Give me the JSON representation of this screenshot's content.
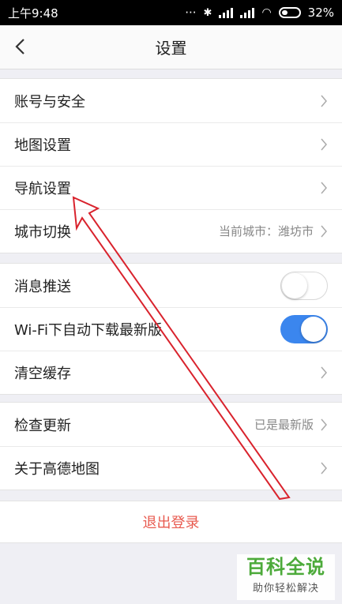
{
  "status_bar": {
    "time": "上午9:48",
    "battery": "32%",
    "icons": [
      "bluetooth-icon",
      "signal-icon",
      "wifi-icon",
      "battery-icon"
    ]
  },
  "nav": {
    "title": "设置",
    "back_icon": "chevron-left-icon"
  },
  "group1": [
    {
      "label": "账号与安全",
      "value": ""
    },
    {
      "label": "地图设置",
      "value": ""
    },
    {
      "label": "导航设置",
      "value": ""
    },
    {
      "label": "城市切换",
      "value": "当前城市：潍坊市"
    }
  ],
  "group2": [
    {
      "label": "消息推送",
      "toggle": "off"
    },
    {
      "label": "Wi-Fi下自动下载最新版",
      "toggle": "on"
    },
    {
      "label": "清空缓存",
      "value": ""
    }
  ],
  "group3": [
    {
      "label": "检查更新",
      "value": "已是最新版"
    },
    {
      "label": "关于高德地图",
      "value": ""
    }
  ],
  "logout": {
    "label": "退出登录"
  },
  "watermark": {
    "title": "百科全说",
    "subtitle": "助你轻松解决"
  },
  "colors": {
    "accent": "#3b86ee",
    "logout": "#e85a4f",
    "annotation_arrow": "#d9232d",
    "watermark": "#4caa3a"
  }
}
